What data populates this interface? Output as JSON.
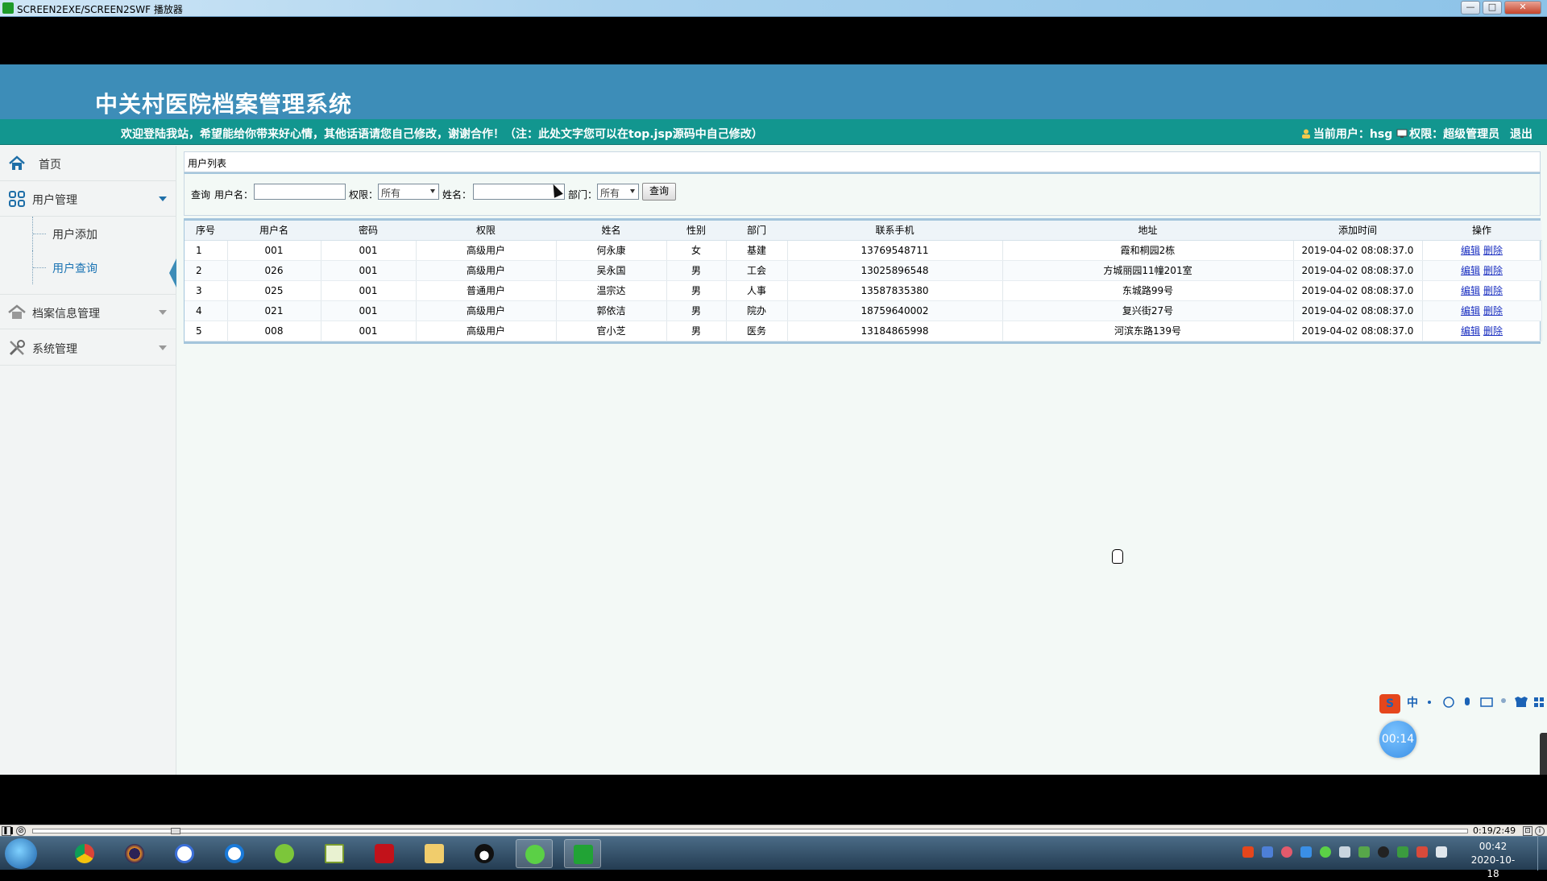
{
  "window": {
    "title": "SCREEN2EXE/SCREEN2SWF 播放器",
    "min_glyph": "—",
    "max_glyph": "□",
    "close_glyph": "✕"
  },
  "page": {
    "system_title": "中关村医院档案管理系统",
    "welcome": "欢迎登陆我站，希望能给你带来好心情，其他话语请您自己修改，谢谢合作！（注：此处文字您可以在top.jsp源码中自己修改）",
    "user_label": "当前用户：hsg",
    "permission_label": "权限：超级管理员",
    "logout": "退出"
  },
  "sidebar": {
    "home": "首页",
    "user_mgmt": "用户管理",
    "user_add": "用户添加",
    "user_query": "用户查询",
    "archive_mgmt": "档案信息管理",
    "system_mgmt": "系统管理"
  },
  "panel": {
    "title": "用户列表"
  },
  "query": {
    "prefix": "查询",
    "username_label": "用户名：",
    "permission_label": "权限：",
    "permission_value": "所有",
    "name_label": "姓名：",
    "dept_label": "部门：",
    "dept_value": "所有",
    "button": "查询"
  },
  "table": {
    "headers": [
      "序号",
      "用户名",
      "密码",
      "权限",
      "姓名",
      "性别",
      "部门",
      "联系手机",
      "地址",
      "添加时间",
      "操作"
    ],
    "rows": [
      [
        "1",
        "001",
        "001",
        "高级用户",
        "何永康",
        "女",
        "基建",
        "13769548711",
        "霞和桐园2栋",
        "2019-04-02 08:08:37.0"
      ],
      [
        "2",
        "026",
        "001",
        "高级用户",
        "吴永国",
        "男",
        "工会",
        "13025896548",
        "方城丽园11幢201室",
        "2019-04-02 08:08:37.0"
      ],
      [
        "3",
        "025",
        "001",
        "普通用户",
        "温宗达",
        "男",
        "人事",
        "13587835380",
        "东城路99号",
        "2019-04-02 08:08:37.0"
      ],
      [
        "4",
        "021",
        "001",
        "高级用户",
        "郭依洁",
        "男",
        "院办",
        "18759640002",
        "复兴街27号",
        "2019-04-02 08:08:37.0"
      ],
      [
        "5",
        "008",
        "001",
        "高级用户",
        "官小芝",
        "男",
        "医务",
        "13184865998",
        "河滨东路139号",
        "2019-04-02 08:08:37.0"
      ]
    ],
    "edit": "编辑",
    "delete": "删除"
  },
  "widgets": {
    "ime_logo": "S",
    "ime_mode": "中",
    "timer": "00:14"
  },
  "player": {
    "time": "0:19/2:49",
    "progress": 0.1
  },
  "taskbar": {
    "time": "00:42",
    "date": "2020-10-18"
  },
  "colors": {
    "header_blue": "#3d8db8",
    "info_teal": "#12968f",
    "link_blue": "#1a2fc0"
  },
  "icons": {
    "home": "home-icon",
    "user_mgmt": "grid-icon",
    "archive": "house-icon",
    "system": "tools-icon"
  }
}
